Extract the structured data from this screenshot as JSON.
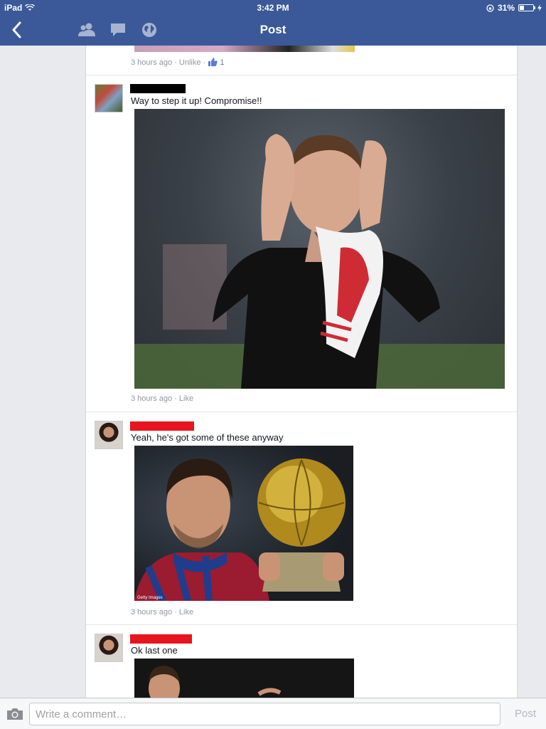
{
  "status": {
    "device": "iPad",
    "time": "3:42 PM",
    "battery": "31%"
  },
  "nav": {
    "title": "Post",
    "icons": [
      "friends-icon",
      "messages-icon",
      "globe-icon"
    ]
  },
  "feed": {
    "top_meta": {
      "time": "3 hours ago",
      "sep": "·",
      "action": "Unlike",
      "likes": "1"
    },
    "comments": [
      {
        "name_redaction": "#000000",
        "text": "Way to step it up! Compromise!!",
        "time": "3 hours ago",
        "sep": "·",
        "action": "Like"
      },
      {
        "name_redaction": "#e8141e",
        "text": "Yeah, he's got some of these anyway",
        "image_caption": "Getty Images",
        "time": "3 hours ago",
        "sep": "·",
        "action": "Like"
      },
      {
        "name_redaction": "#e8141e",
        "text": "Ok last one"
      }
    ]
  },
  "composer": {
    "placeholder": "Write a comment…",
    "post_label": "Post"
  },
  "colors": {
    "header": "#3b5998",
    "like_blue": "#5b7bd5"
  }
}
